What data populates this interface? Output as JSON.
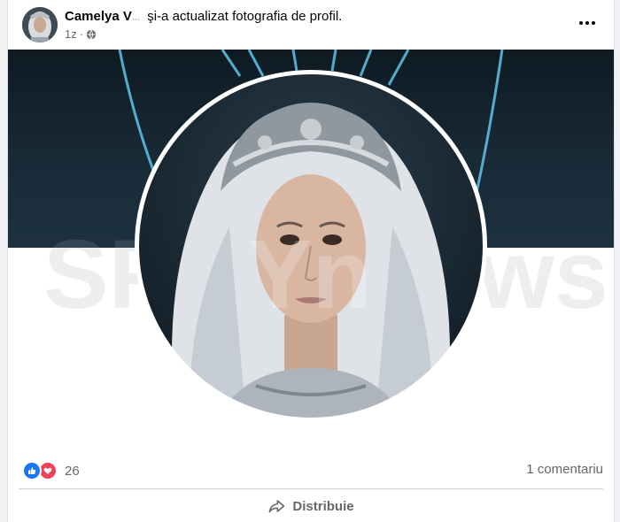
{
  "post": {
    "author_name": "Camelya V",
    "author_name_masked": "...",
    "action_text": "şi-a actualizat fotografia de profil.",
    "timestamp": "1z",
    "audience_icon": "globe-icon",
    "more_icon": "more-horizontal-icon"
  },
  "image": {
    "watermark": "SPYnews",
    "colors": {
      "cover": "#162632",
      "neon": "#5ec6ea",
      "hair": "#e6e9ee"
    }
  },
  "stats": {
    "reaction_icons": [
      "like-icon",
      "love-icon"
    ],
    "reaction_count": "26",
    "comments_label": "1 comentariu"
  },
  "actions": {
    "share_label": "Distribuie",
    "share_icon": "share-arrow-icon"
  },
  "colors": {
    "like": "#1877f2",
    "love": "#f33e58",
    "muted_text": "#65676b",
    "primary_text": "#050505"
  }
}
